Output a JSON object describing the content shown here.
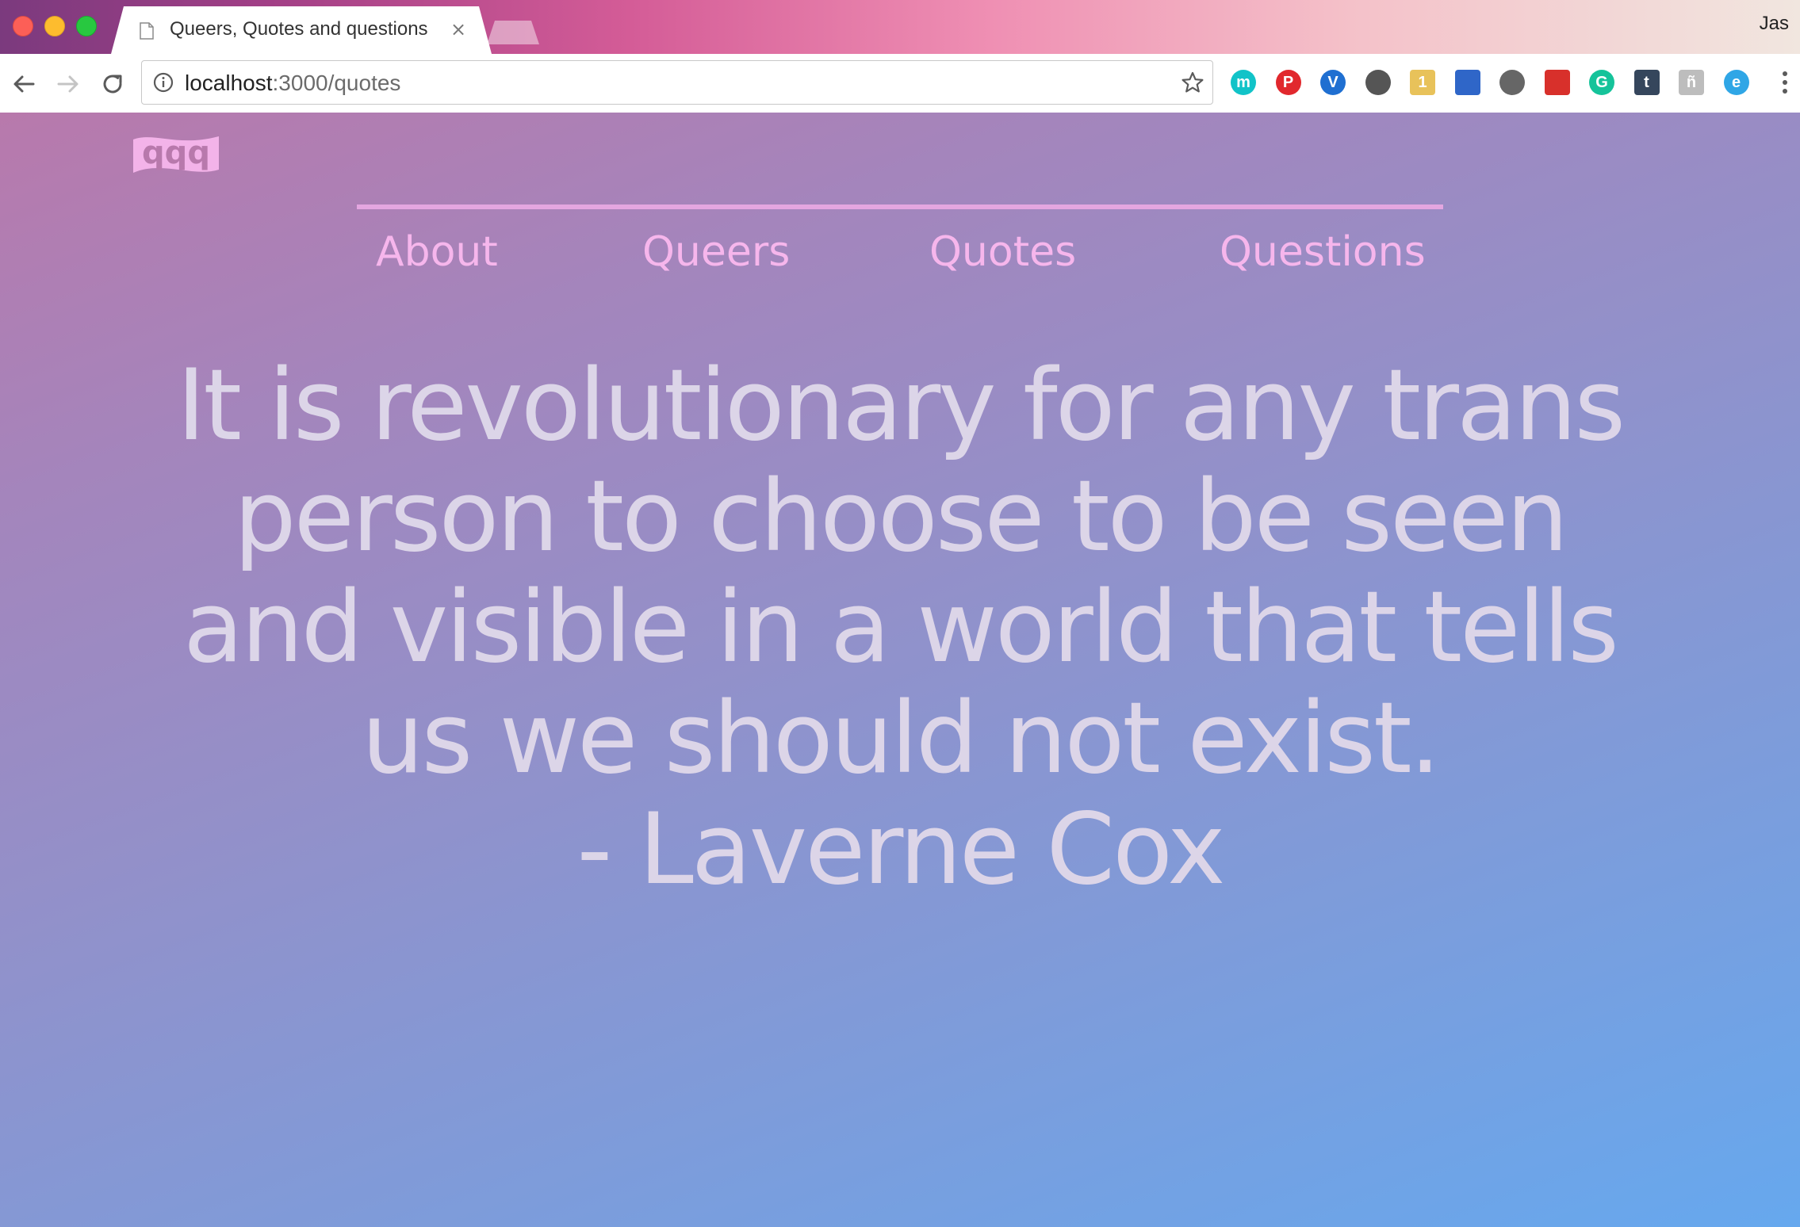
{
  "browser": {
    "tab": {
      "title": "Queers, Quotes and questions",
      "close_glyph": "×"
    },
    "profile_name": "Jas",
    "address_bar": {
      "host": "localhost",
      "path": ":3000/quotes"
    },
    "extensions": [
      {
        "icon": "m-extension-icon",
        "glyph": "m",
        "color": "#11c3c8"
      },
      {
        "icon": "pinterest-icon",
        "glyph": "P",
        "color": "#e1282d"
      },
      {
        "icon": "shield-v-extension-icon",
        "glyph": "V",
        "color": "#1f6fd1"
      },
      {
        "icon": "cast-icon",
        "glyph": "",
        "color": "#555555"
      },
      {
        "icon": "extension-badge-icon",
        "glyph": "1",
        "color": "#e8c25a"
      },
      {
        "icon": "bookmark-extension-icon",
        "glyph": "",
        "color": "#2f66c8"
      },
      {
        "icon": "lightbulb-extension-icon",
        "glyph": "",
        "color": "#666666"
      },
      {
        "icon": "red-extension-icon",
        "glyph": "",
        "color": "#d8302b"
      },
      {
        "icon": "grammarly-icon",
        "glyph": "G",
        "color": "#15c39a"
      },
      {
        "icon": "tumblr-icon",
        "glyph": "t",
        "color": "#35465c"
      },
      {
        "icon": "gray-extension-icon",
        "glyph": "ñ",
        "color": "#bdbdbd"
      },
      {
        "icon": "evernote-clip-icon",
        "glyph": "e",
        "color": "#2fa6e6"
      }
    ]
  },
  "site": {
    "logo_text": "qqq",
    "nav": [
      {
        "label": "About"
      },
      {
        "label": "Queers"
      },
      {
        "label": "Quotes"
      },
      {
        "label": "Questions"
      }
    ],
    "quote": {
      "text": "It is revolutionary for any trans person to choose to be seen and visible in a world that tells us we should not exist.",
      "author": "- Laverne Cox"
    }
  },
  "colors": {
    "nav_link": "#f6b6ec",
    "nav_rule": "#e4a6e0",
    "quote_text": "#dcd5e8",
    "gradient_start": "#b879ac",
    "gradient_end": "#66a8ee"
  }
}
